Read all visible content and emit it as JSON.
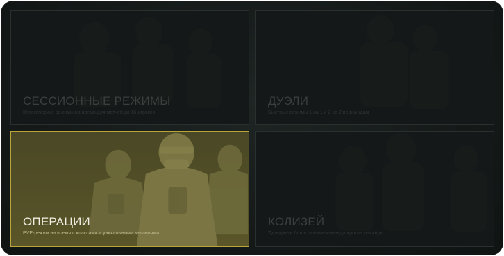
{
  "modes": [
    {
      "title": "СЕССИОННЫЕ РЕЖИМЫ",
      "subtitle": "Классические режимы на время для матчей до 16 игроков",
      "active": false
    },
    {
      "title": "ДУЭЛИ",
      "subtitle": "Быстрые режимы 1 на 1 и 2 на 2 по раундам",
      "active": false
    },
    {
      "title": "ОПЕРАЦИИ",
      "subtitle": "PVE-режим на время с классами и уникальными заданиями",
      "active": true
    },
    {
      "title": "КОЛИЗЕЙ",
      "subtitle": "Турнирные бои в режиме команда против команды",
      "active": false
    }
  ],
  "colors": {
    "active_border": "#b8a63a",
    "active_fill": "#524f27",
    "inactive_fill": "#171c1b"
  }
}
